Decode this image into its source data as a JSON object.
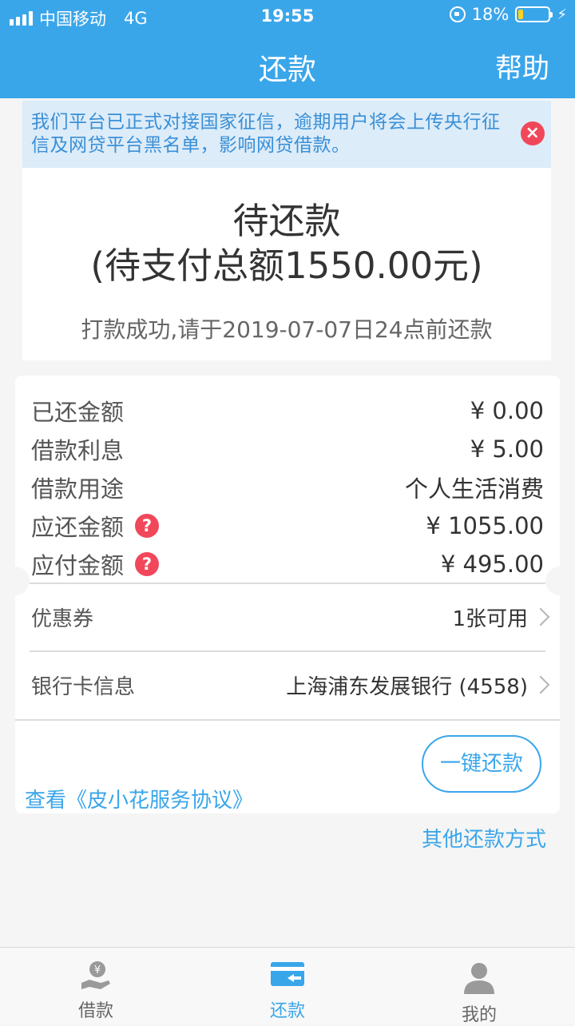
{
  "status_bar": {
    "carrier": "中国移动",
    "network": "4G",
    "time": "19:55",
    "battery": "18%",
    "battery_level": 0.18
  },
  "header": {
    "title": "还款",
    "help": "帮助"
  },
  "notice": {
    "text": "我们平台已正式对接国家征信，逾期用户将会上传央行征信及网贷平台黑名单，影响网贷借款。",
    "close_glyph": "×"
  },
  "status": {
    "title": "待还款",
    "total": "(待支付总额1550.00元)",
    "note": "打款成功,请于2019-07-07日24点前还款"
  },
  "details": [
    {
      "label": "已还金额",
      "value": "¥ 0.00"
    },
    {
      "label": "借款利息",
      "value": "¥ 5.00"
    },
    {
      "label": "借款用途",
      "value": "个人生活消费"
    },
    {
      "label": "应还金额",
      "value": "¥ 1055.00"
    },
    {
      "label": "应付金额",
      "value": "¥ 495.00"
    }
  ],
  "coupon": {
    "label": "优惠券",
    "value": "1张可用"
  },
  "bank": {
    "label": "银行卡信息",
    "value": "上海浦东发展银行 (4558)"
  },
  "pay_button": "一键还款",
  "agreement": "查看《皮小花服务协议》",
  "other_methods": "其他还款方式",
  "tabs": [
    {
      "label": "借款",
      "icon": "loan-icon"
    },
    {
      "label": "还款",
      "icon": "repay-card-icon"
    },
    {
      "label": "我的",
      "icon": "user-icon"
    }
  ],
  "colors": {
    "accent": "#3aa6ea",
    "alert": "#f0485a",
    "notice_bg": "#dcecf9"
  }
}
